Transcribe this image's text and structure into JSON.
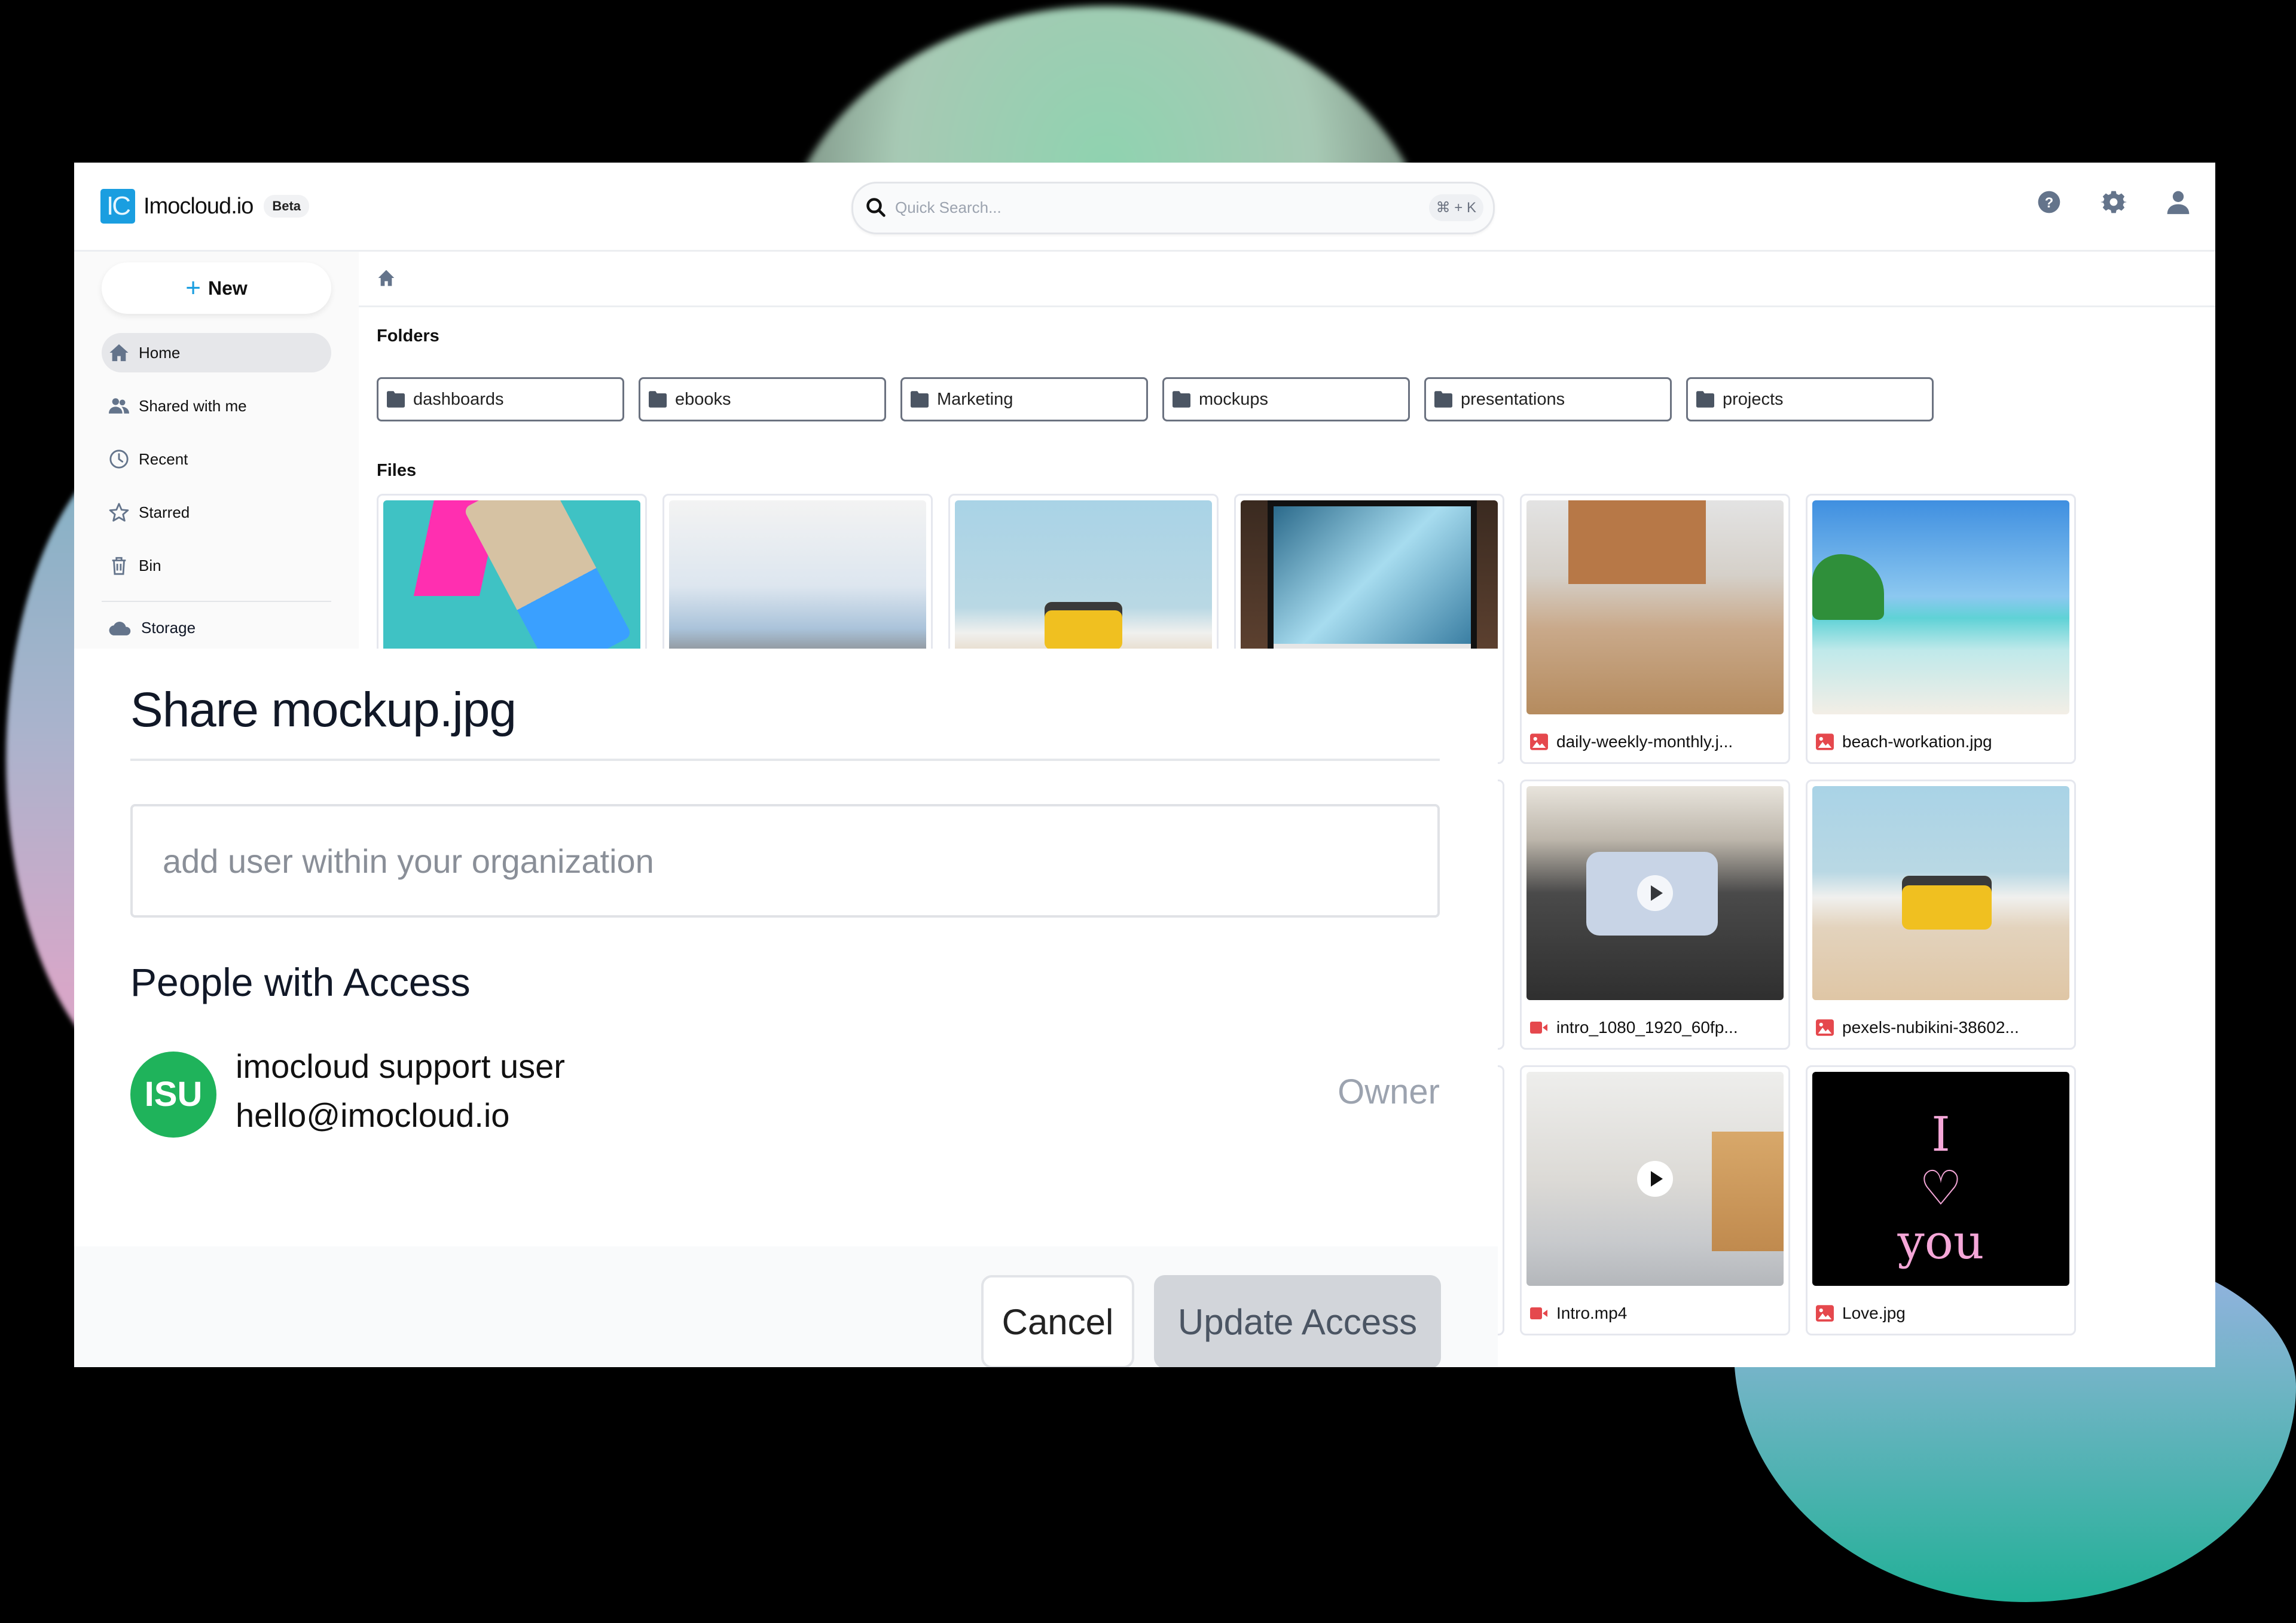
{
  "app": {
    "logo_mark": "IC",
    "name": "Imocloud.io",
    "badge": "Beta",
    "brand_color": "#1a9ee0"
  },
  "search": {
    "placeholder": "Quick Search...",
    "value": "",
    "shortcut": "⌘ + K"
  },
  "top_icons": [
    "help-icon",
    "gear-icon",
    "user-icon"
  ],
  "sidebar": {
    "new_label": "New",
    "items": [
      {
        "label": "Home",
        "icon": "home-icon",
        "active": true
      },
      {
        "label": "Shared with me",
        "icon": "users-icon",
        "active": false
      },
      {
        "label": "Recent",
        "icon": "clock-icon",
        "active": false
      },
      {
        "label": "Starred",
        "icon": "star-icon",
        "active": false
      },
      {
        "label": "Bin",
        "icon": "trash-icon",
        "active": false
      }
    ],
    "storage_label": "Storage"
  },
  "main": {
    "breadcrumb_icon": "home-icon",
    "folders_title": "Folders",
    "folders": [
      "dashboards",
      "ebooks",
      "Marketing",
      "mockups",
      "presentations",
      "projects"
    ],
    "files_title": "Files",
    "files": [
      {
        "name": "",
        "type": "image",
        "thumb": "t-tag"
      },
      {
        "name": "",
        "type": "image",
        "thumb": "t-office"
      },
      {
        "name": "",
        "type": "image",
        "thumb": "t-bus"
      },
      {
        "name": "",
        "type": "image",
        "thumb": "t-dm"
      },
      {
        "name": "daily-weekly-monthly.j...",
        "type": "image",
        "thumb": "t-meeting"
      },
      {
        "name": "beach-workation.jpg",
        "type": "image",
        "thumb": "t-beach"
      },
      {
        "name": "intro_1080_1920_60fp...",
        "type": "video",
        "thumb": "t-rocks"
      },
      {
        "name": "pexels-nubikini-38602...",
        "type": "image",
        "thumb": "t-bus2"
      },
      {
        "name": "Intro.mp4",
        "type": "video",
        "thumb": "t-room"
      },
      {
        "name": "Love.jpg",
        "type": "image",
        "thumb": "t-love"
      }
    ],
    "file_icon_color": "#e5484d"
  },
  "share_modal": {
    "title": "Share mockup.jpg",
    "input_placeholder": "add user within your organization",
    "input_value": "",
    "people_title": "People with Access",
    "people": [
      {
        "initials": "ISU",
        "name": "imocloud support user",
        "email": "hello@imocloud.io",
        "role": "Owner",
        "avatar_color": "#1fb35b"
      }
    ],
    "cancel_label": "Cancel",
    "update_label": "Update Access"
  }
}
